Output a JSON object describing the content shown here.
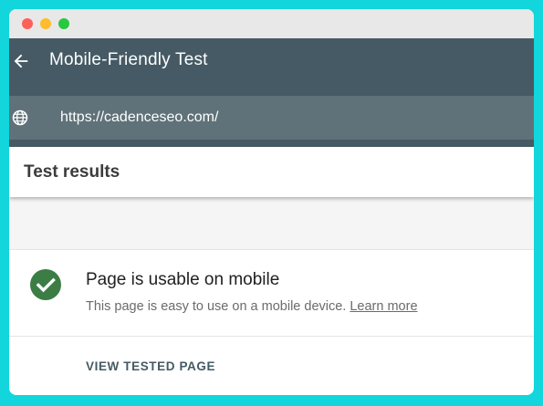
{
  "appbar": {
    "title": "Mobile-Friendly Test",
    "back_icon": "arrow-left-icon"
  },
  "urlbar": {
    "url": "https://cadenceseo.com/",
    "icon": "globe-icon"
  },
  "results": {
    "header": "Test results"
  },
  "result": {
    "title": "Page is usable on mobile",
    "description": "This page is easy to use on a mobile device.",
    "learn_more": "Learn more",
    "status_icon": "check-circle-icon",
    "status_color": "#3b7d45"
  },
  "actions": {
    "view_tested_page": "VIEW TESTED PAGE"
  },
  "colors": {
    "appbar": "#455a64",
    "urlbar": "#607279",
    "background": "#12d6dc"
  }
}
